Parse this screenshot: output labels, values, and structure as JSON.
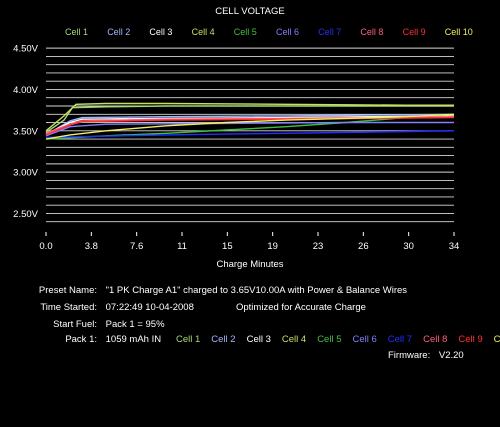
{
  "chart_data": {
    "type": "line",
    "title": "CELL VOLTAGE",
    "xlabel": "Charge Minutes",
    "ylabel": "",
    "xlim": [
      0,
      34
    ],
    "ylim": [
      2.3,
      4.55
    ],
    "x_ticks": [
      "0.0",
      "3.8",
      "7.6",
      "11",
      "15",
      "19",
      "23",
      "26",
      "30",
      "34"
    ],
    "y_ticks": [
      {
        "value": 4.5,
        "label": "4.50V"
      },
      {
        "value": 4.0,
        "label": "4.00V"
      },
      {
        "value": 3.5,
        "label": "3.50V"
      },
      {
        "value": 3.0,
        "label": "3.00V"
      },
      {
        "value": 2.5,
        "label": "2.50V"
      }
    ],
    "grid": true,
    "legend_position": "top",
    "series": [
      {
        "name": "Cell 1",
        "color": "#a8d878",
        "points": [
          [
            0,
            3.48
          ],
          [
            1.5,
            3.63
          ],
          [
            2.2,
            3.78
          ],
          [
            5,
            3.79
          ],
          [
            10,
            3.8
          ],
          [
            20,
            3.8
          ],
          [
            30,
            3.8
          ],
          [
            34,
            3.8
          ]
        ]
      },
      {
        "name": "Cell 2",
        "color": "#9fb6ff",
        "points": [
          [
            0,
            3.45
          ],
          [
            2,
            3.62
          ],
          [
            3,
            3.66
          ],
          [
            10,
            3.67
          ],
          [
            20,
            3.68
          ],
          [
            34,
            3.7
          ]
        ]
      },
      {
        "name": "Cell 3",
        "color": "#ffffff",
        "points": [
          [
            0,
            3.46
          ],
          [
            2,
            3.6
          ],
          [
            3,
            3.64
          ],
          [
            10,
            3.65
          ],
          [
            20,
            3.66
          ],
          [
            34,
            3.68
          ]
        ]
      },
      {
        "name": "Cell 4",
        "color": "#c8e060",
        "points": [
          [
            0,
            3.5
          ],
          [
            1.5,
            3.68
          ],
          [
            2.5,
            3.82
          ],
          [
            5,
            3.83
          ],
          [
            10,
            3.83
          ],
          [
            20,
            3.82
          ],
          [
            30,
            3.81
          ],
          [
            34,
            3.81
          ]
        ]
      },
      {
        "name": "Cell 5",
        "color": "#40c040",
        "points": [
          [
            0,
            3.4
          ],
          [
            5,
            3.44
          ],
          [
            10,
            3.47
          ],
          [
            15,
            3.51
          ],
          [
            20,
            3.55
          ],
          [
            25,
            3.6
          ],
          [
            30,
            3.66
          ],
          [
            34,
            3.7
          ]
        ]
      },
      {
        "name": "Cell 6",
        "color": "#8080ff",
        "points": [
          [
            0,
            3.44
          ],
          [
            2,
            3.55
          ],
          [
            5,
            3.58
          ],
          [
            15,
            3.59
          ],
          [
            25,
            3.6
          ],
          [
            34,
            3.6
          ]
        ]
      },
      {
        "name": "Cell 7",
        "color": "#2030ff",
        "points": [
          [
            0,
            3.42
          ],
          [
            10,
            3.45
          ],
          [
            20,
            3.47
          ],
          [
            34,
            3.5
          ]
        ]
      },
      {
        "name": "Cell 8",
        "color": "#ff6080",
        "points": [
          [
            0,
            3.47
          ],
          [
            2,
            3.58
          ],
          [
            3,
            3.62
          ],
          [
            10,
            3.64
          ],
          [
            20,
            3.65
          ],
          [
            34,
            3.67
          ]
        ]
      },
      {
        "name": "Cell 9",
        "color": "#ff3030",
        "points": [
          [
            0,
            3.45
          ],
          [
            2,
            3.57
          ],
          [
            3,
            3.61
          ],
          [
            10,
            3.63
          ],
          [
            20,
            3.64
          ],
          [
            34,
            3.66
          ]
        ]
      },
      {
        "name": "Cell 10",
        "color": "#f0f060",
        "points": [
          [
            0,
            3.4
          ],
          [
            2,
            3.45
          ],
          [
            5,
            3.5
          ],
          [
            10,
            3.56
          ],
          [
            15,
            3.6
          ],
          [
            20,
            3.63
          ],
          [
            25,
            3.65
          ],
          [
            30,
            3.67
          ],
          [
            34,
            3.7
          ]
        ]
      }
    ]
  },
  "info": {
    "preset_label": "Preset Name:",
    "preset_value": "\"1 PK Charge A1\" charged to 3.65V10.00A with Power & Balance Wires",
    "time_label": "Time Started:",
    "time_value": "07:22:49  10-04-2008",
    "optimized": "Optimized for Accurate Charge",
    "fuel_label": "Start Fuel:",
    "fuel_value": "Pack 1 = 95%",
    "pack_label": "Pack 1:",
    "pack_value": "1059 mAh IN",
    "firmware_label": "Firmware:",
    "firmware_value": "V2.20"
  }
}
